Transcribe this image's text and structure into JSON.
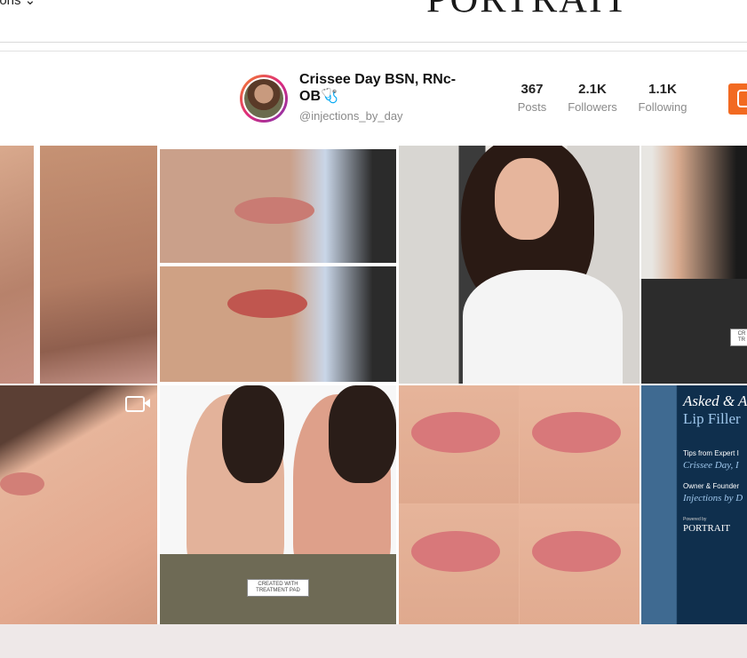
{
  "header": {
    "nav_partial": "ions ⌄",
    "brand": "PORTRAIT"
  },
  "profile": {
    "name": "Crissee Day BSN, RNc-OB🩺",
    "handle": "@injections_by_day",
    "stats": [
      {
        "value": "367",
        "label": "Posts"
      },
      {
        "value": "2.1K",
        "label": "Followers"
      },
      {
        "value": "1.1K",
        "label": "Following"
      }
    ]
  },
  "colors": {
    "accent": "#f26a21",
    "ring_start": "#f58529",
    "ring_end": "#8134af"
  },
  "grid": {
    "video_icon": "video-camera-icon",
    "tile_badges": [
      {
        "line1": "CREATED WITH",
        "line2": "TREATMENT PAD"
      },
      {
        "line1": "CR",
        "line2": "TR"
      }
    ],
    "promo": {
      "title_line1": "Asked & A",
      "title_line2": "Lip Filler",
      "tips_label": "Tips from Expert I",
      "tips_name": "Crissee Day, I",
      "owner_label": "Owner & Founder",
      "owner_biz": "Injections by D",
      "powered_by": "Powered by",
      "powered_brand": "PORTRAIT"
    }
  }
}
